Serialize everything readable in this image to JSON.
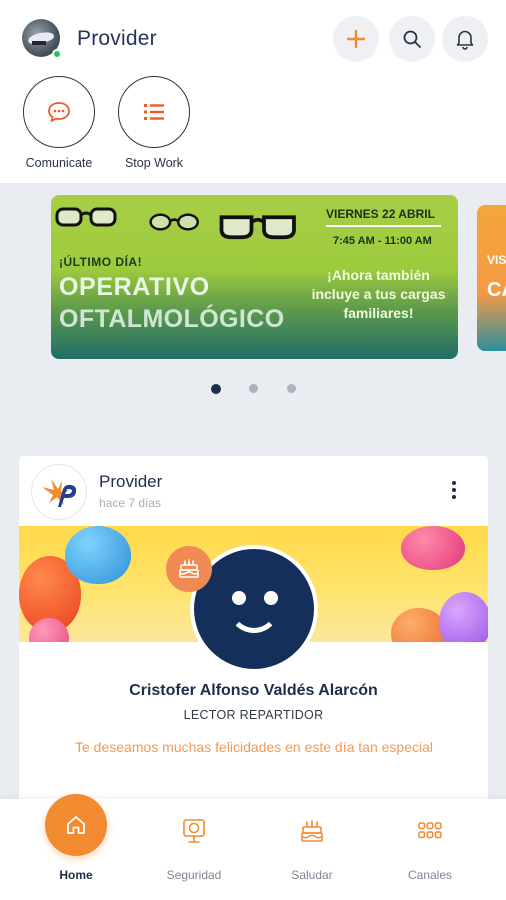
{
  "header": {
    "title": "Provider",
    "actions": [
      {
        "icon": "plus-icon"
      },
      {
        "icon": "search-icon"
      },
      {
        "icon": "bell-icon"
      }
    ]
  },
  "quick_actions": [
    {
      "label": "Comunicate",
      "icon": "chat-bubble-icon"
    },
    {
      "label": "Stop Work",
      "icon": "list-icon"
    }
  ],
  "carousel": {
    "active_index": 0,
    "count": 3,
    "banner": {
      "last_day": "¡ÚLTIMO DÍA!",
      "headline_1": "OPERATIVO",
      "headline_2": "OFTALMOLÓGICO",
      "date": "VIERNES 22 ABRIL",
      "time": "7:45 AM - 11:00 AM",
      "promo": "¡Ahora también incluye a tus cargas familiares!"
    },
    "next_banner_text": [
      "VIS",
      "CA"
    ]
  },
  "post": {
    "author": "Provider",
    "time_ago": "hace 7 días",
    "person_name": "Cristofer Alfonso Valdés Alarcón",
    "role": "LECTOR REPARTIDOR",
    "message": "Te deseamos muchas felicidades en este día tan especial"
  },
  "bottom_nav": {
    "active": "Home",
    "items": [
      {
        "label": "Home",
        "icon": "home-icon"
      },
      {
        "label": "Seguridad",
        "icon": "safety-sign-icon"
      },
      {
        "label": "Saludar",
        "icon": "cake-icon"
      },
      {
        "label": "Canales",
        "icon": "grid-icon"
      }
    ]
  },
  "colors": {
    "accent": "#f28a30",
    "navy": "#1f2d4a",
    "background": "#e9ecf1"
  }
}
